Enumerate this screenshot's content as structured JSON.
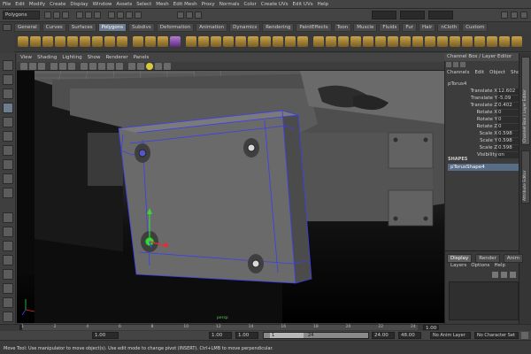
{
  "menubar": [
    "File",
    "Edit",
    "Modify",
    "Create",
    "Display",
    "Window",
    "Assets",
    "Select",
    "Mesh",
    "Edit Mesh",
    "Proxy",
    "Normals",
    "Color",
    "Create UVs",
    "Edit UVs",
    "Help"
  ],
  "status_line": {
    "mode": "Polygons"
  },
  "shelf_tabs": [
    "General",
    "Curves",
    "Surfaces",
    "Polygons",
    "Subdivs",
    "Deformation",
    "Animation",
    "Dynamics",
    "Rendering",
    "PaintEffects",
    "Toon",
    "Muscle",
    "Fluids",
    "Fur",
    "Hair",
    "nCloth",
    "Custom"
  ],
  "active_shelf_tab": "Polygons",
  "panel_menu": [
    "View",
    "Shading",
    "Lighting",
    "Show",
    "Renderer",
    "Panels"
  ],
  "viewport": {
    "camera_label": "persp"
  },
  "channel_box": {
    "title": "Channel Box / Layer Editor",
    "menu": [
      "Channels",
      "Edit",
      "Object",
      "Show"
    ],
    "object_name": "pTorus4",
    "attributes": [
      {
        "name": "Translate X",
        "value": "12.602"
      },
      {
        "name": "Translate Y",
        "value": "-5.09"
      },
      {
        "name": "Translate Z",
        "value": "0.402"
      },
      {
        "name": "Rotate X",
        "value": "0"
      },
      {
        "name": "Rotate Y",
        "value": "0"
      },
      {
        "name": "Rotate Z",
        "value": "0"
      },
      {
        "name": "Scale X",
        "value": "0.598"
      },
      {
        "name": "Scale Y",
        "value": "0.598"
      },
      {
        "name": "Scale Z",
        "value": "0.598"
      },
      {
        "name": "Visibility",
        "value": "on"
      }
    ],
    "shapes_header": "SHAPES",
    "shape_name": "pTorusShape4"
  },
  "side_tabs": [
    "Channel Box / Layer Editor",
    "Attribute Editor"
  ],
  "layer_editor": {
    "tabs": [
      "Display",
      "Render",
      "Anim"
    ],
    "active_tab": "Display",
    "menu": [
      "Layers",
      "Options",
      "Help"
    ]
  },
  "time_slider": {
    "ticks": [
      "1",
      "2",
      "4",
      "6",
      "8",
      "10",
      "12",
      "14",
      "16",
      "18",
      "20",
      "22",
      "24"
    ],
    "current_frame": "1.00"
  },
  "range_slider": {
    "start_time": "1.00",
    "playback_start": "1.00",
    "range_start": "1",
    "range_end": "24",
    "playback_end": "24.00",
    "end_time": "48.00",
    "anim_layer": "No Anim Layer",
    "character_set": "No Character Set"
  },
  "help_line": "Move Tool: Use manipulator to move object(s). Use edit mode to change pivot (INSERT). Ctrl+LMB to move perpendicular.",
  "colors": {
    "active_tab": "#6d7d90",
    "selection": "#576c85",
    "wire": "#3d3df0",
    "vertex_green": "#3cd33c"
  }
}
